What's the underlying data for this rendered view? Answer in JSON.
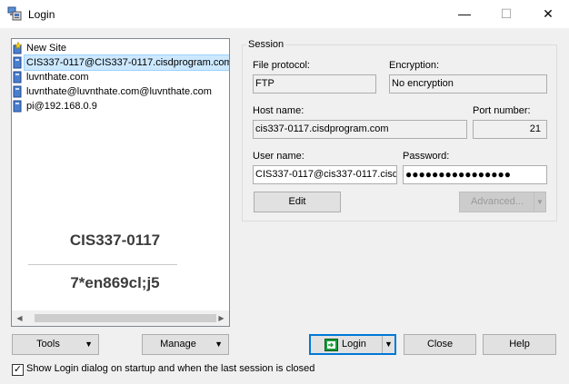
{
  "window": {
    "title": "Login",
    "app_icon": "computer-network-icon",
    "minimize": "—",
    "maximize": "☐",
    "close": "✕"
  },
  "sites": [
    {
      "label": "New Site",
      "icon": "new-site-icon"
    },
    {
      "label": "CIS337-0117@CIS337-0117.cisdprogram.com",
      "icon": "computer-icon",
      "selected": true
    },
    {
      "label": "luvnthate.com",
      "icon": "computer-icon"
    },
    {
      "label": "luvnthate@luvnthate.com@luvnthate.com",
      "icon": "computer-icon"
    },
    {
      "label": "pi@192.168.0.9",
      "icon": "computer-icon"
    }
  ],
  "banner": {
    "line1": "CIS337-0117",
    "line2": "7*en869cl;j5"
  },
  "session": {
    "legend": "Session",
    "file_protocol_label": "File protocol:",
    "file_protocol_value": "FTP",
    "encryption_label": "Encryption:",
    "encryption_value": "No encryption",
    "host_label": "Host name:",
    "host_value": "cis337-0117.cisdprogram.com",
    "port_label": "Port number:",
    "port_value": "21",
    "user_label": "User name:",
    "user_value": "CIS337-0117@cis337-0117.cisd",
    "password_label": "Password:",
    "password_value": "●●●●●●●●●●●●●●●●",
    "edit_button": "Edit",
    "advanced_button": "Advanced..."
  },
  "bottom": {
    "tools_button": "Tools",
    "manage_button": "Manage",
    "login_button": "Login",
    "close_button": "Close",
    "help_button": "Help",
    "show_login_checkbox": "Show Login dialog on startup and when the last session is closed",
    "show_login_checked": true
  },
  "colors": {
    "accent": "#0078d7",
    "selection": "#cce8ff",
    "login_icon_green": "#1a9a3a"
  }
}
